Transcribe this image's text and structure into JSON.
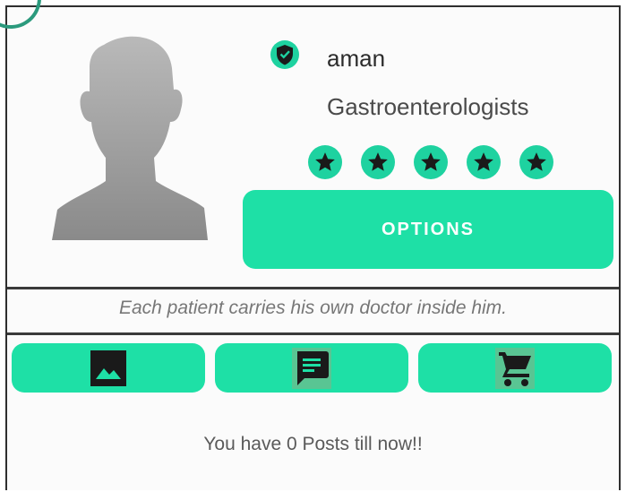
{
  "profile": {
    "username": "aman",
    "specialty": "Gastroenterologists",
    "rating_stars": 5,
    "rating_max": 5,
    "verified_icon": "shield-check-icon",
    "avatar_icon": "person-silhouette-icon"
  },
  "actions": {
    "options_label": "OPTIONS"
  },
  "quote": "Each patient carries his own doctor inside him.",
  "tabs": [
    {
      "icon": "image-icon"
    },
    {
      "icon": "message-icon"
    },
    {
      "icon": "cart-icon"
    }
  ],
  "posts_message": "You have 0 Posts till now!!",
  "colors": {
    "accent": "#1ee0a6",
    "star": "#1a1a1a",
    "text_dark": "#2c2c2c",
    "divider": "#3a3a3a"
  }
}
